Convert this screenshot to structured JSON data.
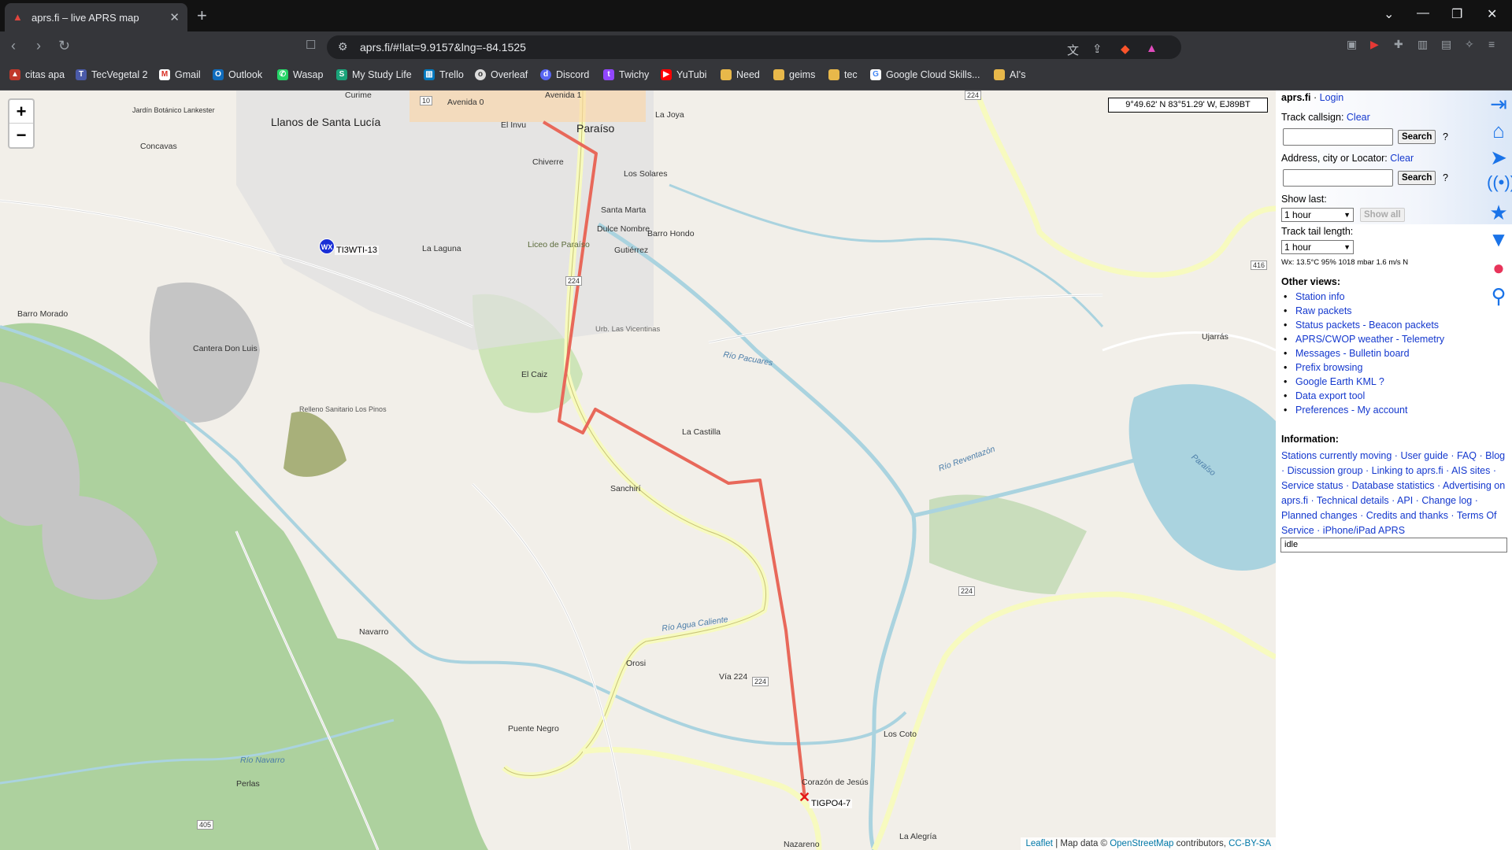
{
  "browser": {
    "tab_title": "aprs.fi – live APRS map",
    "url": "aprs.fi/#!lat=9.9157&lng=-84.1525",
    "bookmarks": [
      "citas apa",
      "TecVegetal 2",
      "Gmail",
      "Outlook",
      "Wasap",
      "My Study Life",
      "Trello",
      "Overleaf",
      "Discord",
      "Twichy",
      "YuTubi",
      "Need",
      "geims",
      "tec",
      "Google Cloud Skills...",
      "AI's"
    ]
  },
  "map": {
    "coords_readout": "9°49.62' N 83°51.29' W, EJ89BT",
    "zoom_in": "+",
    "zoom_out": "−",
    "stations": {
      "wx_icon": "WX",
      "wx_station": "TI3WTI-13",
      "mobile_station": "TIGPO4-7"
    },
    "place_labels": {
      "paraiso": "Paraíso",
      "llanos": "Llanos de Santa Lucía",
      "concavas": "Concavas",
      "jardin": "Jardín Botánico Lankester",
      "curime": "Curime",
      "la_laguna": "La Laguna",
      "liceo": "Liceo de Paraíso",
      "barro_morado": "Barro Morado",
      "cantera": "Cantera Don Luis",
      "relleno": "Relleno Sanitario Los Pinos",
      "el_caiz": "El Caiz",
      "urb": "Urb. Las Vicentinas",
      "la_castilla": "La Castilla",
      "sanchiri": "Sanchirí",
      "navarro": "Navarro",
      "puente_negro": "Puente Negro",
      "perlas": "Perlas",
      "orosi": "Orosi",
      "dulce_nombre": "Dulce Nombre",
      "santa_marta": "Santa Marta",
      "barrio_hondo": "Barro Hondo",
      "gutierrez": "Gutiérrez",
      "los_solares": "Los Solares",
      "la_joya": "La Joya",
      "chiverre": "Chiverre",
      "el_invu": "El Invu",
      "ujarras": "Ujarrás",
      "los_coto": "Los Coto",
      "corazon": "Corazón de Jesús",
      "la_alegria": "La Alegría",
      "nazareno": "Nazareno"
    },
    "road_labels": {
      "v224": "Vía 224",
      "r224": "224",
      "r416": "416",
      "r405": "405",
      "r10": "10",
      "avenida0": "Avenida 0",
      "avenida1": "Avenida 1"
    },
    "water_labels": {
      "pacuares": "Río Pacuares",
      "reventazon": "Río Reventazón",
      "agua_caliente": "Río Agua Caliente",
      "navarro_rio": "Río Navarro",
      "paraiso_rio": "Paraíso"
    },
    "attribution": {
      "leaflet": "Leaflet",
      "mapdata": "| Map data ©",
      "osm": "OpenStreetMap",
      "contrib": "contributors,",
      "license": "CC-BY-SA"
    }
  },
  "panel": {
    "site": "aprs.fi",
    "login": "Login",
    "track_label": "Track callsign:",
    "clear1": "Clear",
    "search1": "Search",
    "q1": "?",
    "address_label": "Address, city or Locator:",
    "clear2": "Clear",
    "search2": "Search",
    "q2": "?",
    "show_last_label": "Show last:",
    "show_last_value": "1 hour",
    "show_all": "Show all",
    "tail_label": "Track tail length:",
    "tail_value": "1 hour",
    "wx_line": "Wx: 13.5°C 95% 1018 mbar 1.6 m/s N",
    "other_views_title": "Other views:",
    "views": [
      "Station info",
      "Raw packets",
      "Status packets - Beacon packets",
      "APRS/CWOP weather - Telemetry",
      "Messages - Bulletin board",
      "Prefix browsing",
      "Google Earth KML ?",
      "Data export tool",
      "Preferences - My account"
    ],
    "info_title": "Information:",
    "info_text": "Stations currently moving · User guide · FAQ · Blog · Discussion group · Linking to aprs.fi · AIS sites · Service status · Database statistics · Advertising on aprs.fi · Technical details · API · Change log · Planned changes · Credits and thanks · Terms Of Service · iPhone/iPad APRS",
    "status_box": "idle"
  }
}
